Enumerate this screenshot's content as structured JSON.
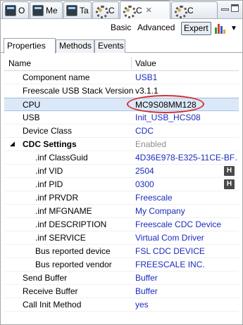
{
  "view_tabs": [
    {
      "label": "O",
      "icon": "console-icon",
      "active": false
    },
    {
      "label": "Me",
      "icon": "console-icon",
      "active": false
    },
    {
      "label": "Ta",
      "icon": "console-icon",
      "active": false
    },
    {
      "label": "C",
      "icon": "gear-icon",
      "active": false
    },
    {
      "label": "C",
      "icon": "gear-icon",
      "active": true
    },
    {
      "label": "C",
      "icon": "gear-icon",
      "active": false
    }
  ],
  "close_symbol": "✕",
  "toolbar": {
    "basic_label": "Basic",
    "advanced_label": "Advanced",
    "expert_label": "Expert",
    "selected": "Expert"
  },
  "inner_tabs": [
    "Properties",
    "Methods",
    "Events"
  ],
  "table": {
    "col_name": "Name",
    "col_value": "Value",
    "rows": [
      {
        "name": "Component name",
        "value": "USB1",
        "style": "blue"
      },
      {
        "name": "Freescale USB Stack Version",
        "value": "v3.1.1",
        "style": "black"
      },
      {
        "name": "CPU",
        "value": "MC9S08MM128",
        "style": "black"
      },
      {
        "name": "USB",
        "value": "Init_USB_HCS08",
        "style": "blue"
      },
      {
        "name": "Device Class",
        "value": "CDC",
        "style": "blue"
      },
      {
        "name": "CDC Settings",
        "value": "Enabled",
        "style": "gray"
      },
      {
        "name": ".inf ClassGuid",
        "value": "4D36E978-E325-11CE-BF…",
        "style": "blue"
      },
      {
        "name": ".inf VID",
        "value": "2504",
        "style": "blue"
      },
      {
        "name": ".inf PID",
        "value": "0300",
        "style": "blue"
      },
      {
        "name": ".inf PRVDR",
        "value": "Freescale",
        "style": "blue"
      },
      {
        "name": ".inf MFGNAME",
        "value": "My Company",
        "style": "blue"
      },
      {
        "name": ".inf DESCRIPTION",
        "value": "Freescale CDC Device",
        "style": "blue"
      },
      {
        "name": ".inf SERVICE",
        "value": "Virtual Com Driver",
        "style": "blue"
      },
      {
        "name": "Bus reported device",
        "value": "FSL CDC DEVICE",
        "style": "blue"
      },
      {
        "name": "Bus reported vendor",
        "value": "FREESCALE INC.",
        "style": "blue"
      },
      {
        "name": "Send Buffer",
        "value": "Buffer",
        "style": "blue"
      },
      {
        "name": "Receive Buffer",
        "value": "Buffer",
        "style": "blue"
      },
      {
        "name": "Call Init Method",
        "value": "yes",
        "style": "blue"
      }
    ],
    "h_button_label": "H",
    "expand_symbol": "◢"
  },
  "colors": {
    "value_blue": "#1b2bbf",
    "selected_row": "#dbe8f8",
    "annotation_red": "#d23030"
  }
}
